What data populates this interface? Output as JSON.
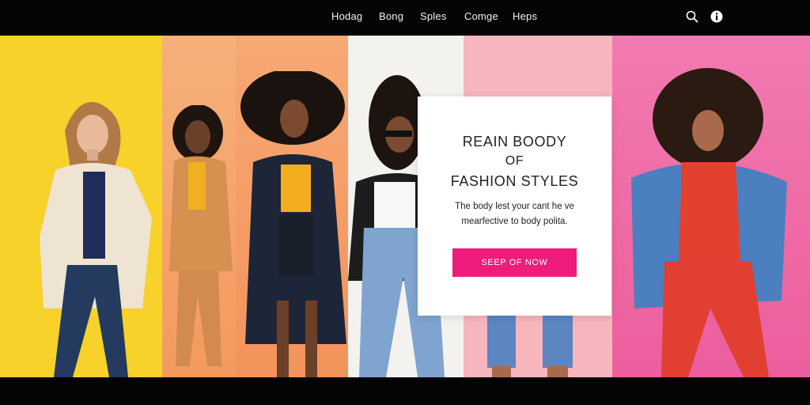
{
  "nav": {
    "links": [
      "Hodag",
      "Bong",
      "Sples",
      "Comge",
      "Heps"
    ]
  },
  "icons": {
    "search": "search-icon",
    "info": "info-icon"
  },
  "hero": {
    "strip_colors": [
      "#f6d22a",
      "#f3a065",
      "#f5a26b",
      "#f2f1ee",
      "#f6b3bd",
      "#f06aa8"
    ],
    "card": {
      "title_line1": "REAIN BOODY",
      "title_line2": "OF",
      "title_line3": "FASHION STYLES",
      "sub_line1": "The body lest your cant he ve",
      "sub_line2": "mearfective to body polita.",
      "cta_label": "SEEP OF NOW"
    }
  },
  "colors": {
    "accent": "#ee1c7a",
    "bar": "#050505"
  }
}
